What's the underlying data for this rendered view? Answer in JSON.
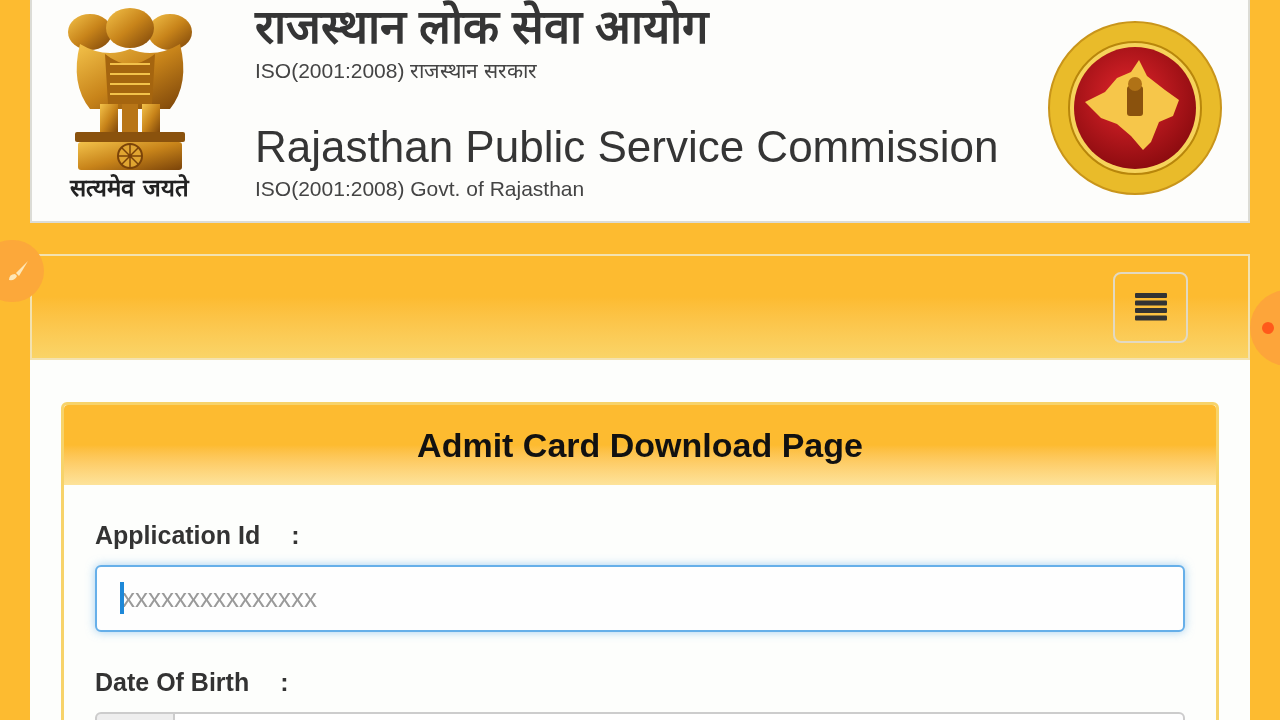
{
  "header": {
    "emblem_motto": "सत्यमेव जयते",
    "title_hindi": "राजस्थान लोक सेवा आयोग",
    "subtitle_hindi": "ISO(2001:2008) राजस्थान सरकार",
    "title_english": "Rajasthan Public Service Commission",
    "subtitle_english": "ISO(2001:2008) Govt. of Rajasthan"
  },
  "panel": {
    "title": "Admit Card Download Page",
    "fields": [
      {
        "kind": "text",
        "label": "Application Id",
        "separator": ":",
        "placeholder": "xxxxxxxxxxxxxxx",
        "focused": true
      },
      {
        "kind": "date",
        "label": "Date Of Birth",
        "separator": ":",
        "focused": false
      }
    ]
  }
}
